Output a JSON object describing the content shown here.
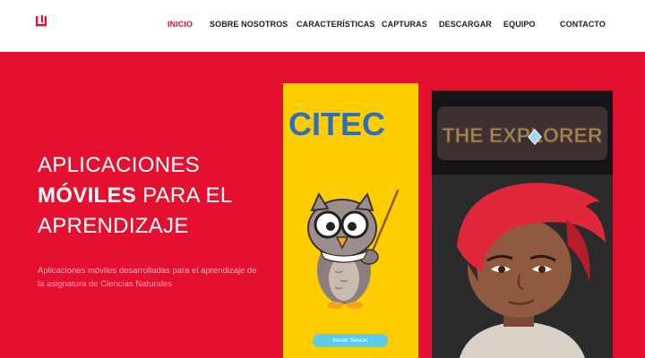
{
  "nav": {
    "logo_icon": "brand-mark",
    "items": [
      {
        "label": "INICIO",
        "active": true
      },
      {
        "label": "SOBRE NOSOTROS"
      },
      {
        "label": "CARACTERÍSTICAS"
      },
      {
        "label": "CAPTURAS"
      },
      {
        "label": "DESCARGAR"
      },
      {
        "label": "EQUIPO"
      },
      {
        "label": "CONTACTO"
      }
    ]
  },
  "hero": {
    "title_line1": "APLICACIONES",
    "title_bold": "MÓVILES",
    "title_rest": " PARA EL",
    "title_line3": "APRENDIZAJE",
    "subtitle": "Aplicaciones móviles desarrolladas para el aprendizaje de la asignatura de Ciencias Naturales"
  },
  "screenshots": {
    "app1": {
      "logo_text": "CITEC",
      "login_button": "Iniciar Sesión"
    },
    "app2": {
      "logo_text": "THE EXPLORER"
    }
  },
  "colors": {
    "accent": "#e5102f",
    "nav_active": "#cc1133",
    "app1_bg": "#fecd00",
    "app1_logo": "#2e6fb8",
    "app1_button": "#5ccbe8"
  }
}
